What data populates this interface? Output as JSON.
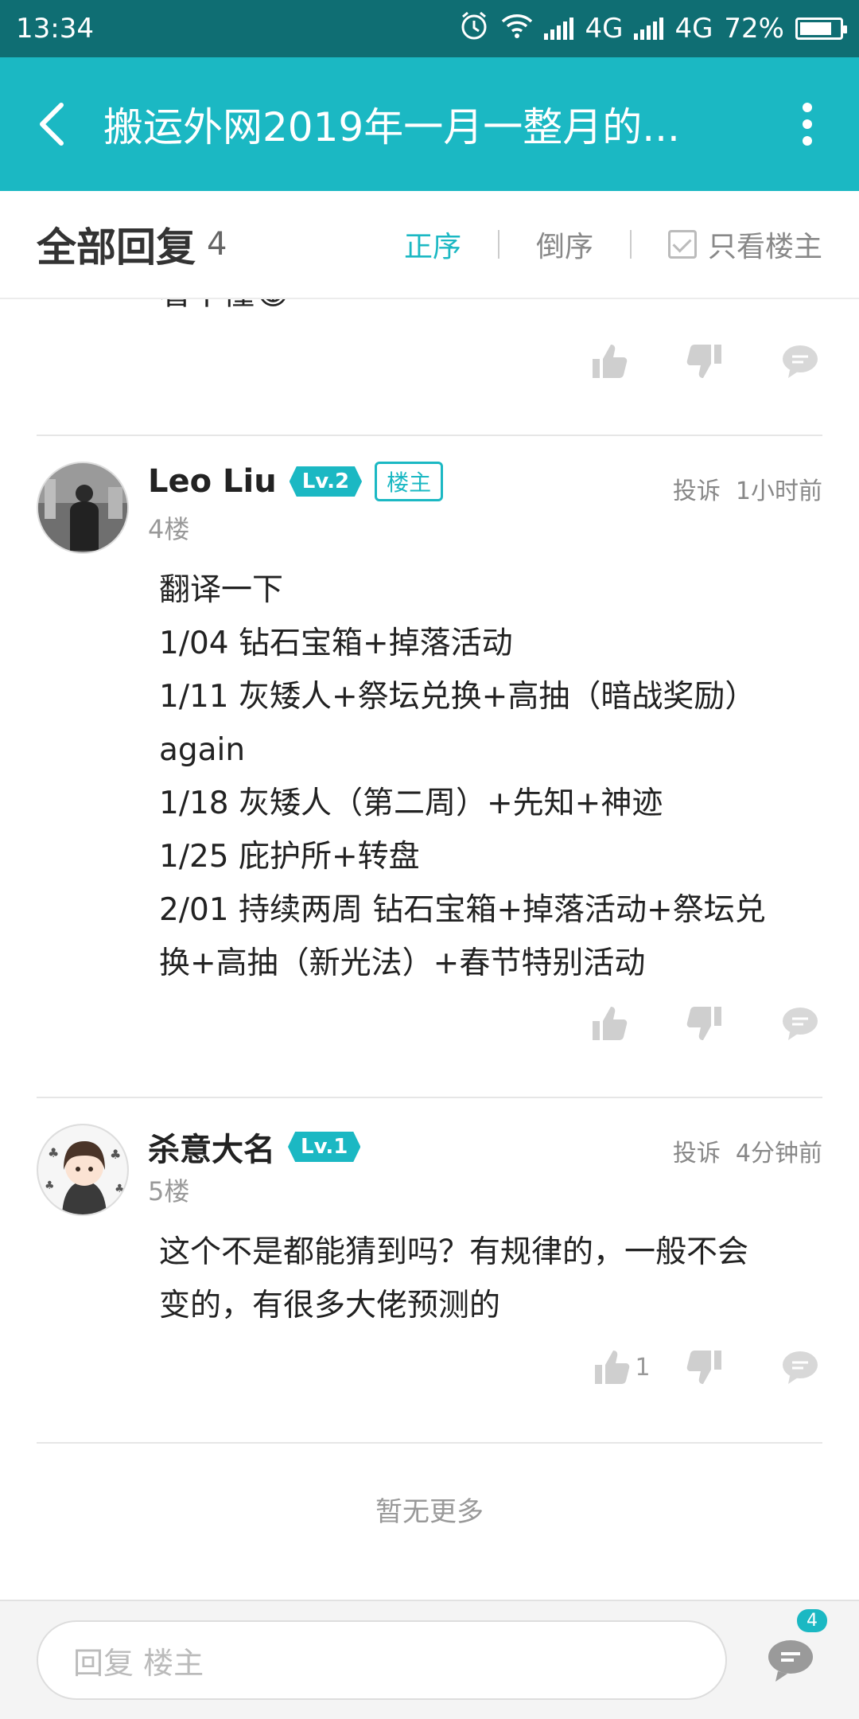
{
  "status_bar": {
    "time": "13:34",
    "net1": "4G",
    "net2": "4G",
    "battery": "72%"
  },
  "header": {
    "title": "搬运外网2019年一月一整月的..."
  },
  "tabs": {
    "all_replies_label": "全部回复",
    "count": "4",
    "sort_asc": "正序",
    "sort_desc": "倒序",
    "only_op": "只看楼主"
  },
  "partial_comment": {
    "text": "看不懂😂"
  },
  "posts": [
    {
      "author": "Leo Liu",
      "level": "Lv.2",
      "op_badge": "楼主",
      "report": "投诉",
      "time": "1小时前",
      "floor": "4楼",
      "lines": [
        "翻译一下",
        "1/04 钻石宝箱+掉落活动",
        "1/11 灰矮人+祭坛兑换+高抽（暗战奖励）",
        "again",
        "1/18 灰矮人（第二周）+先知+神迹",
        "1/25 庇护所+转盘",
        "2/01 持续两周 钻石宝箱+掉落活动+祭坛兑",
        "换+高抽（新光法）+春节特别活动"
      ],
      "likes": ""
    },
    {
      "author": "杀意大名",
      "level": "Lv.1",
      "report": "投诉",
      "time": "4分钟前",
      "floor": "5楼",
      "lines": [
        "这个不是都能猜到吗？有规律的，一般不会",
        "变的，有很多大佬预测的"
      ],
      "likes": "1"
    }
  ],
  "footer": {
    "no_more": "暂无更多"
  },
  "bottom_bar": {
    "reply_placeholder": "回复  楼主",
    "comment_badge": "4"
  },
  "colors": {
    "accent": "#1bb8c3",
    "status_bar": "#0f6e73"
  }
}
